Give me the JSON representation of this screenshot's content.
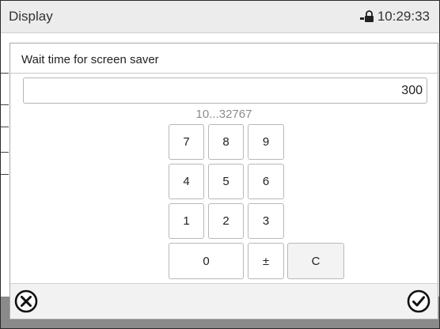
{
  "header": {
    "title": "Display",
    "time": "10:29:33",
    "lock_icon": "lock-icon"
  },
  "dialog": {
    "title": "Wait time for screen saver",
    "value": "300",
    "range": "10...32767",
    "keys": {
      "k7": "7",
      "k8": "8",
      "k9": "9",
      "k4": "4",
      "k5": "5",
      "k6": "6",
      "k1": "1",
      "k2": "2",
      "k3": "3",
      "k0": "0",
      "plusminus": "±",
      "clear": "C"
    },
    "cancel_icon": "cancel-icon",
    "confirm_icon": "confirm-icon"
  },
  "colors": {
    "header_bg": "#ececec",
    "bottom_bar": "#8a8a8a",
    "range_text": "#8c8c8c"
  }
}
